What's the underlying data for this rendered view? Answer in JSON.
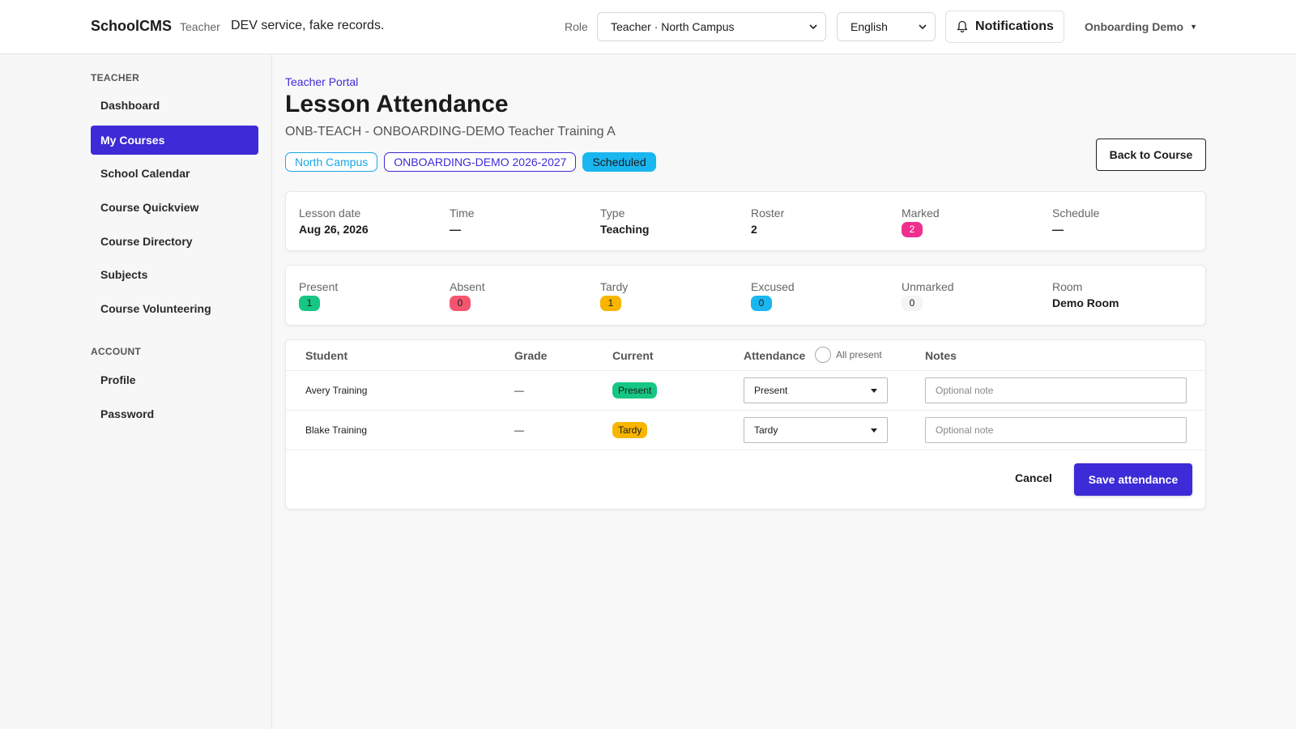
{
  "header": {
    "brand": "SchoolCMS",
    "brand_role": "Teacher",
    "env_note": "DEV service, fake records.",
    "role_label": "Role",
    "role_value": "Teacher · North Campus",
    "language_value": "English",
    "notifications_label": "Notifications",
    "user_name": "Onboarding Demo"
  },
  "sidebar": {
    "section_teacher": "TEACHER",
    "section_account": "ACCOUNT",
    "items": [
      {
        "label": "Dashboard"
      },
      {
        "label": "My Courses"
      },
      {
        "label": "School Calendar"
      },
      {
        "label": "Course Quickview"
      },
      {
        "label": "Course Directory"
      },
      {
        "label": "Subjects"
      },
      {
        "label": "Course Volunteering"
      }
    ],
    "account_items": [
      {
        "label": "Profile"
      },
      {
        "label": "Password"
      }
    ]
  },
  "main": {
    "breadcrumb": "Teacher Portal",
    "title": "Lesson Attendance",
    "subtitle": "ONB-TEACH - ONBOARDING-DEMO Teacher Training A",
    "chips": {
      "campus": "North Campus",
      "year": "ONBOARDING-DEMO 2026-2027",
      "status": "Scheduled"
    },
    "back_button": "Back to Course",
    "lesson_info": {
      "lesson_date_label": "Lesson date",
      "lesson_date": "Aug 26, 2026",
      "time_label": "Time",
      "time": "—",
      "type_label": "Type",
      "type": "Teaching",
      "roster_label": "Roster",
      "roster": "2",
      "marked_label": "Marked",
      "marked": "2",
      "schedule_label": "Schedule",
      "schedule": "—"
    },
    "counts": {
      "present_label": "Present",
      "present": "1",
      "absent_label": "Absent",
      "absent": "0",
      "tardy_label": "Tardy",
      "tardy": "1",
      "excused_label": "Excused",
      "excused": "0",
      "unmarked_label": "Unmarked",
      "unmarked": "0",
      "room_label": "Room",
      "room": "Demo Room"
    },
    "table": {
      "headers": {
        "student": "Student",
        "grade": "Grade",
        "current": "Current",
        "attendance": "Attendance",
        "all_present": "All present",
        "notes": "Notes"
      },
      "rows": [
        {
          "student": "Avery Training",
          "grade": "—",
          "current": "Present",
          "attendance": "Present",
          "note_placeholder": "Optional note"
        },
        {
          "student": "Blake Training",
          "grade": "—",
          "current": "Tardy",
          "attendance": "Tardy",
          "note_placeholder": "Optional note"
        }
      ]
    },
    "cancel_label": "Cancel",
    "save_label": "Save attendance"
  },
  "colors": {
    "primary": "#3c2bd6",
    "present": "#16c784",
    "absent": "#f4566f",
    "tardy": "#f7b500",
    "excused": "#19b6f0",
    "marked": "#ef2e8e"
  }
}
